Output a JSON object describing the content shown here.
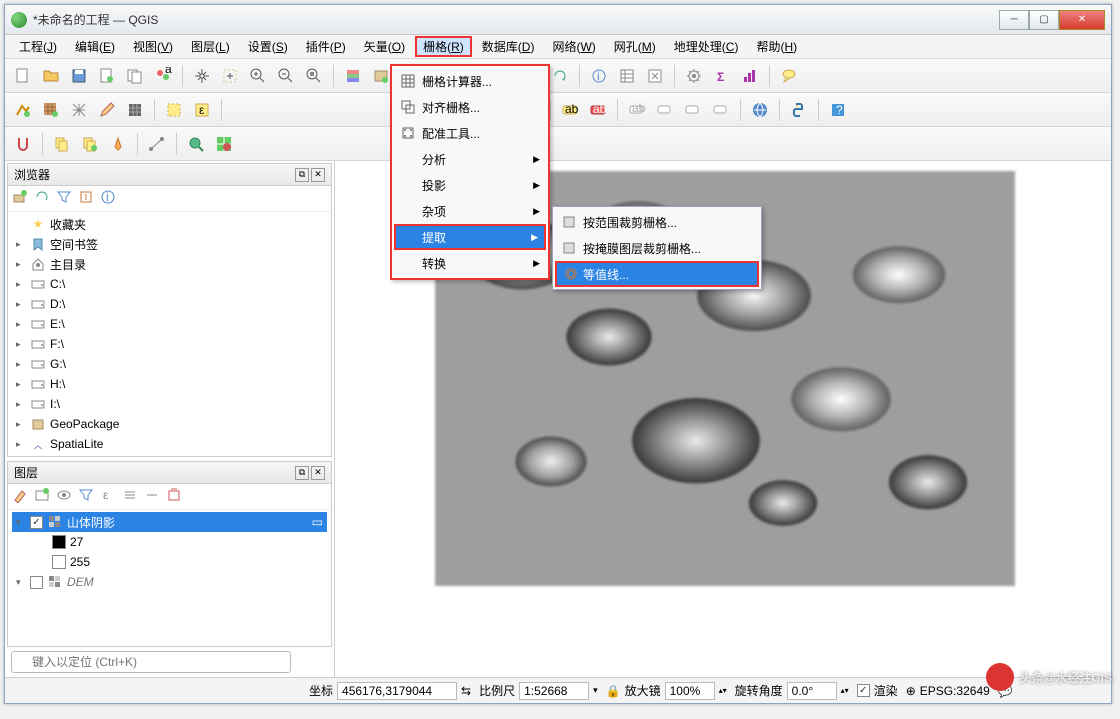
{
  "window": {
    "title": "*未命名的工程 — QGIS"
  },
  "menubar": [
    {
      "label": "工程",
      "key": "J"
    },
    {
      "label": "编辑",
      "key": "E"
    },
    {
      "label": "视图",
      "key": "V"
    },
    {
      "label": "图层",
      "key": "L"
    },
    {
      "label": "设置",
      "key": "S"
    },
    {
      "label": "插件",
      "key": "P"
    },
    {
      "label": "矢量",
      "key": "O"
    },
    {
      "label": "栅格",
      "key": "R",
      "active": true
    },
    {
      "label": "数据库",
      "key": "D"
    },
    {
      "label": "网络",
      "key": "W"
    },
    {
      "label": "网孔",
      "key": "M"
    },
    {
      "label": "地理处理",
      "key": "C"
    },
    {
      "label": "帮助",
      "key": "H"
    }
  ],
  "raster_menu": [
    {
      "label": "栅格计算器...",
      "icon": "grid"
    },
    {
      "label": "对齐栅格...",
      "icon": "align"
    },
    {
      "label": "配准工具...",
      "icon": "georef"
    },
    {
      "label": "分析",
      "sub": true
    },
    {
      "label": "投影",
      "sub": true
    },
    {
      "label": "杂项",
      "sub": true
    },
    {
      "label": "提取",
      "sub": true,
      "hl": true
    },
    {
      "label": "转换",
      "sub": true
    }
  ],
  "extract_submenu": [
    {
      "label": "按范围裁剪栅格...",
      "icon": "clip"
    },
    {
      "label": "按掩膜图层裁剪栅格...",
      "icon": "mask"
    },
    {
      "label": "等值线...",
      "icon": "contour",
      "hl": true
    }
  ],
  "browser": {
    "title": "浏览器",
    "items": [
      {
        "label": "收藏夹",
        "icon": "star"
      },
      {
        "label": "空间书签",
        "icon": "bookmark",
        "exp": true
      },
      {
        "label": "主目录",
        "icon": "home",
        "exp": true
      },
      {
        "label": "C:\\",
        "icon": "drive",
        "exp": true
      },
      {
        "label": "D:\\",
        "icon": "drive",
        "exp": true
      },
      {
        "label": "E:\\",
        "icon": "drive",
        "exp": true
      },
      {
        "label": "F:\\",
        "icon": "drive",
        "exp": true
      },
      {
        "label": "G:\\",
        "icon": "drive",
        "exp": true
      },
      {
        "label": "H:\\",
        "icon": "drive",
        "exp": true
      },
      {
        "label": "I:\\",
        "icon": "drive",
        "exp": true
      },
      {
        "label": "GeoPackage",
        "icon": "gpkg",
        "exp": true
      },
      {
        "label": "SpatiaLite",
        "icon": "slite",
        "exp": true
      }
    ]
  },
  "layers": {
    "title": "图层",
    "items": [
      {
        "label": "山体阴影",
        "checked": true,
        "sel": true,
        "raster": true
      },
      {
        "label": "27",
        "swatch": "#000",
        "indent": 2
      },
      {
        "label": "255",
        "swatch": "#fff",
        "indent": 2
      },
      {
        "label": "DEM",
        "checked": false,
        "raster": true,
        "italic": true
      }
    ]
  },
  "statusbar": {
    "locator_placeholder": "键入以定位 (Ctrl+K)",
    "coord_label": "坐标",
    "coord": "456176,3179044",
    "scale_label": "比例尺",
    "scale": "1:52668",
    "mag_label": "放大镜",
    "mag": "100%",
    "rot_label": "旋转角度",
    "rot": "0.0°",
    "render_label": "渲染",
    "epsg": "EPSG:32649"
  },
  "watermark": "头条@水经注GIS"
}
